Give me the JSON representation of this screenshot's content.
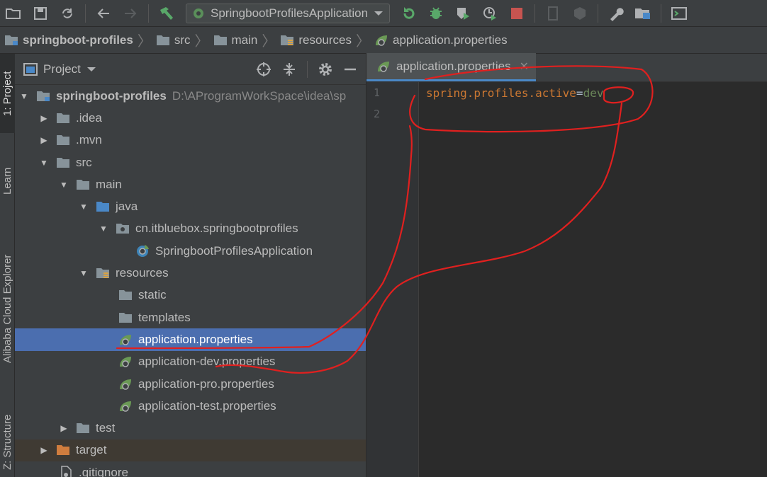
{
  "toolbar": {
    "run_config": "SpringbootProfilesApplication"
  },
  "breadcrumb": [
    "springboot-profiles",
    "src",
    "main",
    "resources",
    "application.properties"
  ],
  "stripe": {
    "tab_project": "1: Project",
    "tab_learn": "Learn",
    "tab_cloud": "Alibaba Cloud Explorer",
    "tab_structure": "Z: Structure"
  },
  "project": {
    "title": "Project",
    "root_name": "springboot-profiles",
    "root_path": "D:\\AProgramWorkSpace\\idea\\sp",
    "items": [
      {
        "label": "idea_text",
        "text": ".idea"
      },
      {
        "text": ".mvn"
      },
      {
        "text": "src"
      },
      {
        "text": "main"
      },
      {
        "text": "java"
      },
      {
        "text": "cn.itbluebox.springbootprofiles"
      },
      {
        "text": "SpringbootProfilesApplication"
      },
      {
        "text": "resources"
      },
      {
        "text": "static"
      },
      {
        "text": "templates"
      },
      {
        "text": "application.properties"
      },
      {
        "text": "application-dev.properties"
      },
      {
        "text": "application-pro.properties"
      },
      {
        "text": "application-test.properties"
      },
      {
        "text": "test"
      },
      {
        "text": "target"
      },
      {
        "text": ".gitignore"
      }
    ]
  },
  "editor": {
    "tab_label": "application.properties",
    "line_numbers": [
      "1",
      "2"
    ],
    "line1_key": "spring.profiles.active",
    "line1_eq": "=",
    "line1_value": "dev"
  },
  "colors": {
    "selection": "#4b6eaf",
    "annotation": "#e0201f",
    "keyword": "#cc7832",
    "string": "#6a8759"
  }
}
